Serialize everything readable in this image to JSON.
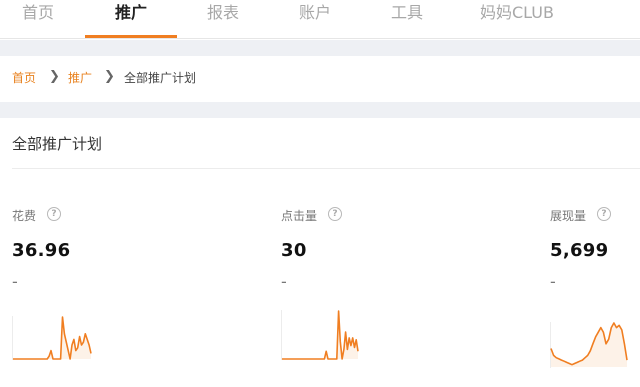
{
  "nav": {
    "items": [
      "首页",
      "推广",
      "报表",
      "账户",
      "工具",
      "妈妈CLUB"
    ],
    "active": "推广"
  },
  "breadcrumb": {
    "items": [
      "首页",
      "推广",
      "全部推广计划"
    ]
  },
  "panel": {
    "title": "全部推广计划",
    "metrics": [
      {
        "label": "花费",
        "value": "36.96",
        "change": "-",
        "trend": [
          0,
          0,
          0,
          0,
          0,
          0,
          0,
          0,
          0,
          0,
          0,
          0,
          0,
          0,
          0,
          0,
          0,
          0,
          0,
          2,
          6,
          0,
          0,
          0,
          0,
          0,
          30,
          18,
          12,
          6,
          0,
          10,
          14,
          6,
          8,
          16,
          10,
          12,
          18,
          14,
          10,
          4
        ]
      },
      {
        "label": "点击量",
        "value": "30",
        "change": "-",
        "trend": [
          0,
          0,
          0,
          0,
          0,
          0,
          0,
          0,
          0,
          0,
          0,
          0,
          0,
          0,
          0,
          0,
          0,
          0,
          0,
          0,
          0,
          0,
          0,
          0,
          0,
          8,
          0,
          0,
          0,
          0,
          0,
          0,
          50,
          18,
          0,
          10,
          28,
          10,
          22,
          14,
          22,
          12,
          20,
          8
        ]
      },
      {
        "label": "展现量",
        "value": "5,699",
        "change": "-",
        "trend": [
          16,
          10,
          8,
          7,
          6,
          5,
          4,
          3,
          2,
          3,
          4,
          5,
          6,
          8,
          10,
          14,
          20,
          26,
          30,
          34,
          30,
          20,
          24,
          34,
          38,
          34,
          36,
          32,
          20,
          6
        ]
      }
    ]
  },
  "colors": {
    "accent": "#f07e21",
    "link": "#e8821f",
    "spark_fill": "#fdf2e8"
  }
}
